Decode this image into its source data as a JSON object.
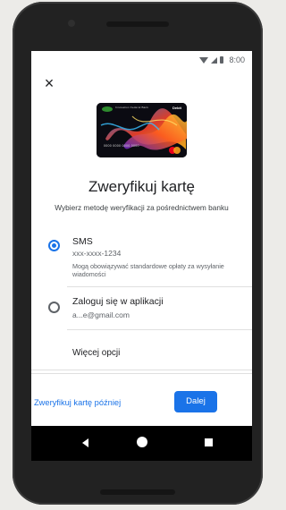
{
  "status_bar": {
    "time": "8:00"
  },
  "icons": {
    "close": "close-icon",
    "wifi": "wifi-icon",
    "signal": "signal-icon",
    "battery": "battery-icon",
    "nav_back": "back-triangle-icon",
    "nav_home": "home-circle-icon",
    "nav_recents": "recents-square-icon"
  },
  "card": {
    "bank_name": "Innovation Federal Bank",
    "type_label": "Debit",
    "number": "0000 0000 0000 0000"
  },
  "title": "Zweryfikuj kartę",
  "subtitle": "Wybierz metodę weryfikacji za pośrednictwem banku",
  "options": [
    {
      "title": "SMS",
      "detail": "xxx-xxxx-1234",
      "note": "Mogą obowiązywać standardowe opłaty za wysyłanie wiadomości",
      "selected": true
    },
    {
      "title": "Zaloguj się w aplikacji",
      "detail": "a...e@gmail.com",
      "selected": false
    }
  ],
  "more_options": "Więcej opcji",
  "actions": {
    "later": "Zweryfikuj kartę później",
    "next": "Dalej"
  },
  "colors": {
    "accent": "#1a73e8",
    "text": "#202124",
    "secondary_text": "#5f6368"
  }
}
